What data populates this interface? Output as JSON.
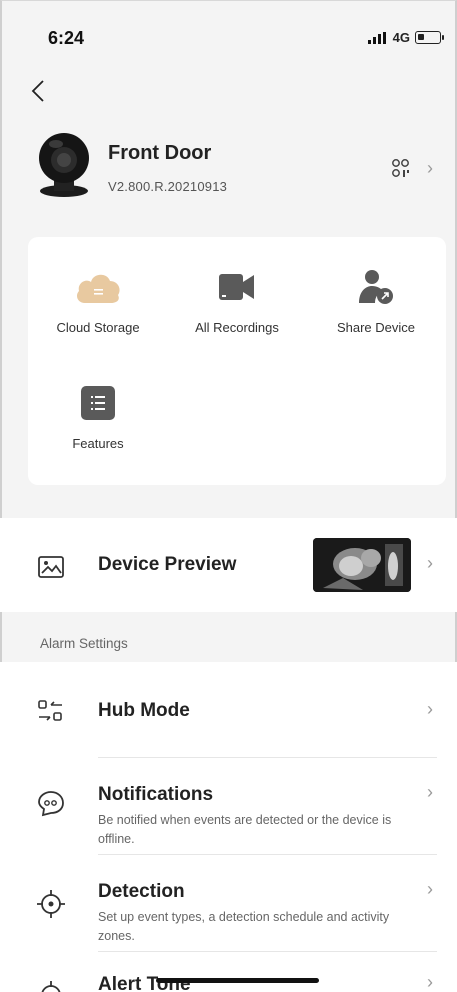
{
  "status": {
    "time": "6:24",
    "network": "4G"
  },
  "device": {
    "name": "Front Door",
    "version": "V2.800.R.20210913"
  },
  "quick_actions": [
    {
      "label": "Cloud Storage",
      "icon": "cloud-icon"
    },
    {
      "label": "All Recordings",
      "icon": "video-camera-icon"
    },
    {
      "label": "Share Device",
      "icon": "share-user-icon"
    },
    {
      "label": "Features",
      "icon": "list-icon"
    }
  ],
  "device_preview": {
    "title": "Device Preview"
  },
  "alarm_settings": {
    "label": "Alarm Settings",
    "items": [
      {
        "title": "Hub Mode",
        "subtitle": "",
        "icon": "hub-mode-icon"
      },
      {
        "title": "Notifications",
        "subtitle": "Be notified when events are detected or the device is offline.",
        "icon": "chat-bubble-icon"
      },
      {
        "title": "Detection",
        "subtitle": "Set up event types, a detection schedule and activity zones.",
        "icon": "crosshair-icon"
      },
      {
        "title": "Alert Tone",
        "subtitle": "",
        "icon": "crosshair-icon"
      }
    ]
  },
  "colors": {
    "cloud": "#e8c9a0",
    "icon_gray": "#555555",
    "background": "#f4f4f4"
  }
}
